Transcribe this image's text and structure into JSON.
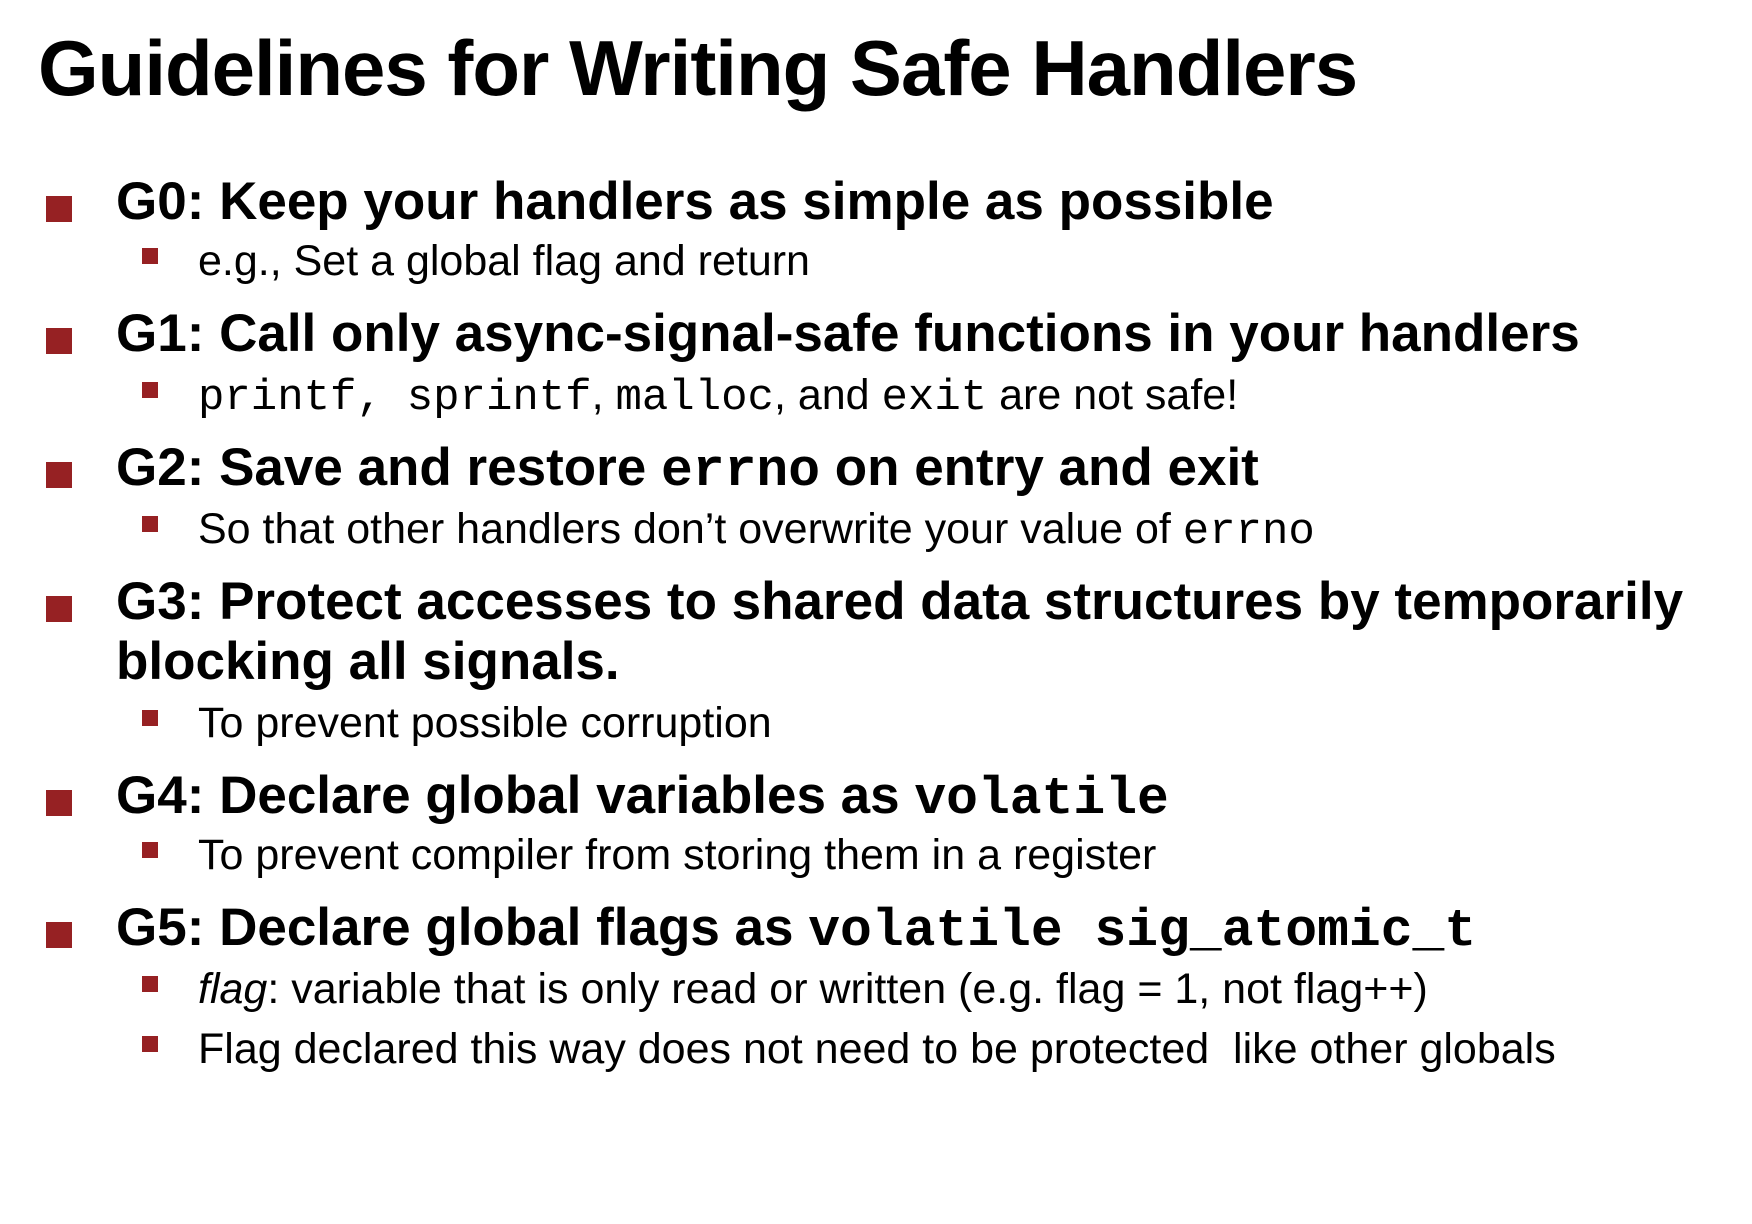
{
  "title": "Guidelines for Writing Safe Handlers",
  "accent_color": "#962123",
  "g0": {
    "heading": "G0: Keep your handlers as simple as possible",
    "sub1": "e.g., Set a global flag and return"
  },
  "g1": {
    "heading": "G1: Call only async-signal-safe functions in your handlers",
    "sub1": {
      "code1": "printf,",
      "code2": "sprintf",
      "sep1": ",",
      "code3": "malloc",
      "sep2": ", and",
      "code4": "exit",
      "tail": "are not safe!"
    }
  },
  "g2": {
    "heading_pre": "G2: Save and restore",
    "heading_code": "errno",
    "heading_post": "on entry and exit",
    "sub1_pre": "So that other handlers don’t overwrite your value of",
    "sub1_code": "errno"
  },
  "g3": {
    "heading_line1": "G3: Protect accesses to shared data structures by temporarily",
    "heading_line2": "blocking all signals.",
    "sub1": "To prevent possible corruption"
  },
  "g4": {
    "heading_pre": "G4: Declare global variables as",
    "heading_code": "volatile",
    "sub1": "To prevent compiler from storing them in a register"
  },
  "g5": {
    "heading_pre": "G5: Declare global flags as",
    "heading_code": "volatile sig_atomic_t",
    "sub1_ital": "flag",
    "sub1_rest": ": variable that is only read or written (e.g. flag = 1, not flag++)",
    "sub2": "Flag declared this way does not need to be protected  like other globals"
  }
}
